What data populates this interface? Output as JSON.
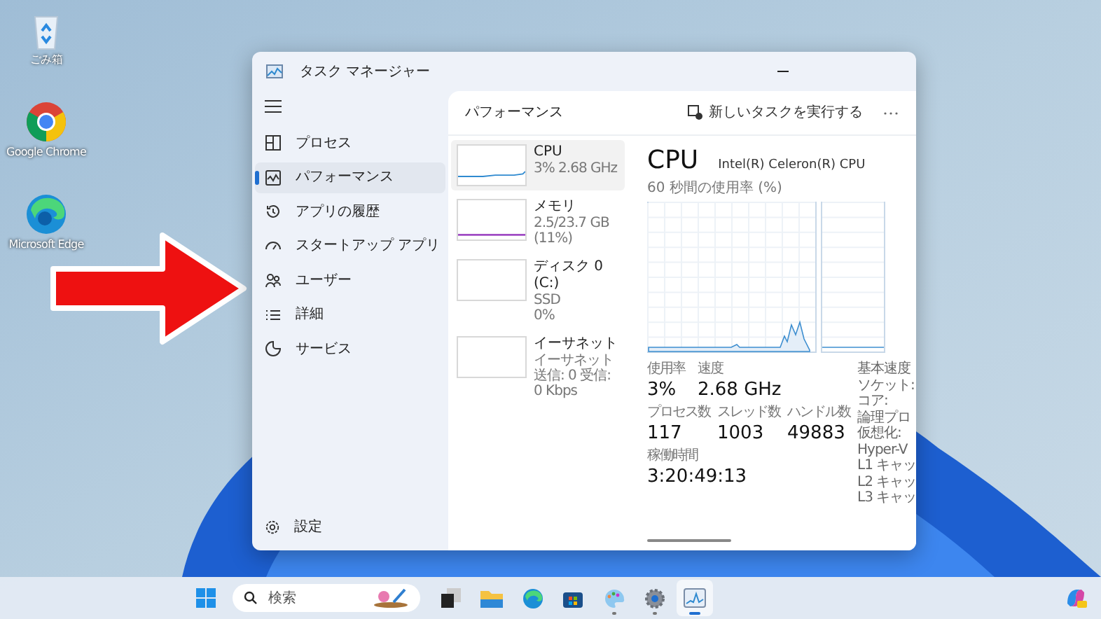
{
  "desktop_icons": [
    {
      "kind": "recycle",
      "label": "ごみ箱"
    },
    {
      "kind": "chrome",
      "label": "Google Chrome"
    },
    {
      "kind": "edge",
      "label": "Microsoft Edge"
    }
  ],
  "window": {
    "title": "タスク マネージャー"
  },
  "sidebar": {
    "items": [
      {
        "kind": "processes",
        "label": "プロセス",
        "selected": false
      },
      {
        "kind": "performance",
        "label": "パフォーマンス",
        "selected": true
      },
      {
        "kind": "history",
        "label": "アプリの履歴",
        "selected": false
      },
      {
        "kind": "startup",
        "label": "スタートアップ アプリ",
        "selected": false
      },
      {
        "kind": "users",
        "label": "ユーザー",
        "selected": false
      },
      {
        "kind": "details",
        "label": "詳細",
        "selected": false
      },
      {
        "kind": "services",
        "label": "サービス",
        "selected": false
      }
    ],
    "settings": "設定"
  },
  "header": {
    "title": "パフォーマンス",
    "new_task": "新しいタスクを実行する"
  },
  "resources": [
    {
      "kind": "cpu",
      "name": "CPU",
      "lines": [
        "3%  2.68 GHz"
      ],
      "selected": true
    },
    {
      "kind": "memory",
      "name": "メモリ",
      "lines": [
        "2.5/23.7 GB (11%)"
      ],
      "selected": false
    },
    {
      "kind": "disk",
      "name": "ディスク 0 (C:)",
      "lines": [
        "SSD",
        "0%"
      ],
      "selected": false
    },
    {
      "kind": "ethernet",
      "name": "イーサネット",
      "lines": [
        "イーサネット",
        "送信: 0 受信: 0 Kbps"
      ],
      "selected": false
    }
  ],
  "detail": {
    "title": "CPU",
    "model": "Intel(R) Celeron(R) CPU",
    "graph_label": "60 秒間の使用率 (%)",
    "stat_rows": [
      [
        {
          "label": "使用率",
          "value": "3%"
        },
        {
          "label": "速度",
          "value": "2.68 GHz"
        }
      ],
      [
        {
          "label": "プロセス数",
          "value": "117"
        },
        {
          "label": "スレッド数",
          "value": "1003"
        },
        {
          "label": "ハンドル数",
          "value": "49883"
        }
      ],
      [
        {
          "label": "稼働時間",
          "value": "3:20:49:13"
        }
      ]
    ],
    "specs": [
      "基本速度",
      "ソケット:",
      "コア:",
      "論理プロ",
      "仮想化:",
      "Hyper-V",
      "L1 キャッ",
      "L2 キャッ",
      "L3 キャッ"
    ]
  },
  "taskbar": {
    "search_placeholder": "検索",
    "apps": [
      {
        "kind": "taskview",
        "running": false,
        "selected": false
      },
      {
        "kind": "explorer",
        "running": false,
        "selected": false
      },
      {
        "kind": "edge",
        "running": false,
        "selected": false
      },
      {
        "kind": "store",
        "running": false,
        "selected": false
      },
      {
        "kind": "paint",
        "running": true,
        "selected": false
      },
      {
        "kind": "settings",
        "running": true,
        "selected": false
      },
      {
        "kind": "taskmanager",
        "running": true,
        "selected": true
      }
    ]
  }
}
